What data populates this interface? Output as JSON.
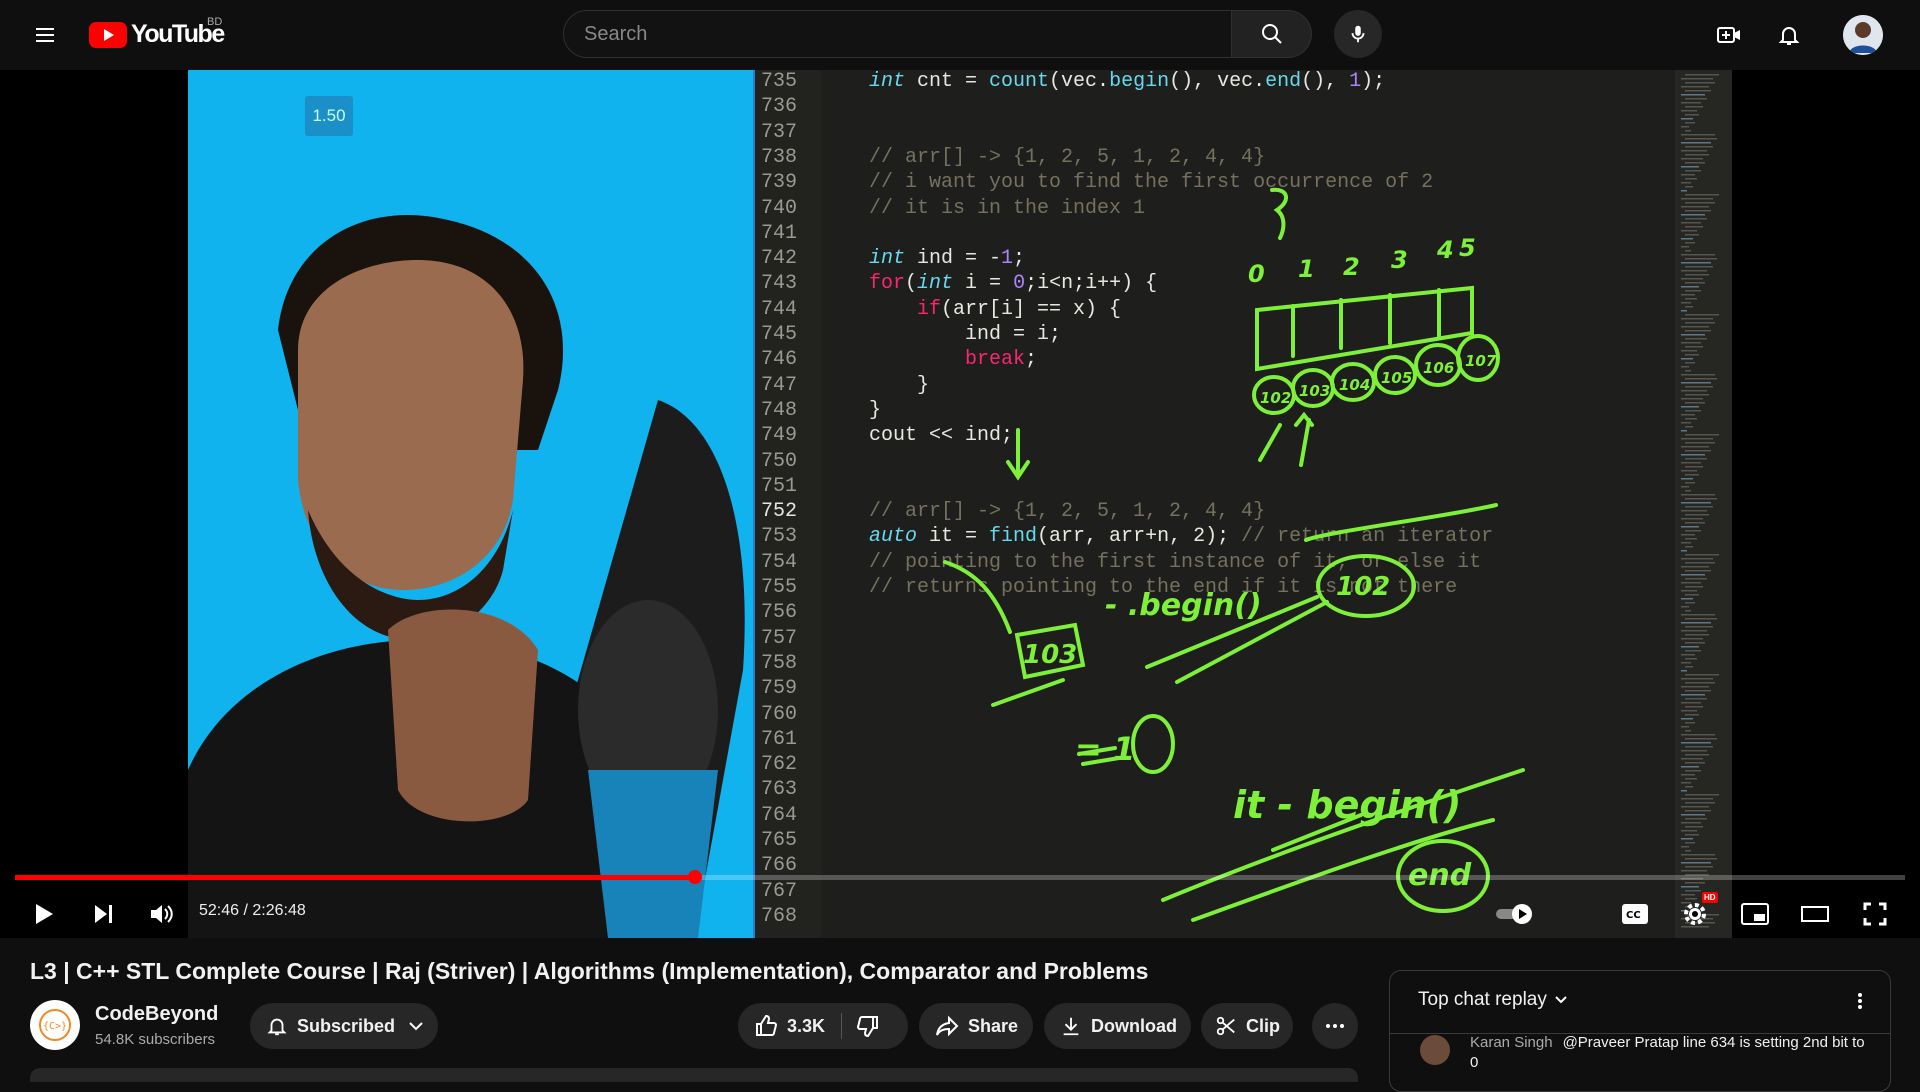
{
  "masthead": {
    "logo_text": "YouTube",
    "country_code": "BD",
    "search_placeholder": "Search"
  },
  "player": {
    "speed_overlay": "1.50",
    "current_time": "52:46",
    "duration": "2:26:48",
    "time_display": "52:46 / 2:26:48",
    "progress_fraction": 0.36,
    "hd_badge": "HD",
    "editor": {
      "line_numbers": [
        "735",
        "736",
        "737",
        "738",
        "739",
        "740",
        "741",
        "742",
        "743",
        "744",
        "745",
        "746",
        "747",
        "748",
        "749",
        "750",
        "751",
        "752",
        "753",
        "754",
        "755",
        "756",
        "757",
        "758",
        "759",
        "760",
        "761",
        "762",
        "763",
        "764",
        "765",
        "766",
        "767",
        "768"
      ],
      "current_line": "752",
      "code": [
        [
          "int",
          " cnt = ",
          "count",
          "(vec.",
          "begin",
          "(), vec.",
          "end",
          "(), ",
          "1",
          ");"
        ],
        [],
        [],
        [
          "// arr[] -> {1, 2, 5, 1, 2, 4, 4}"
        ],
        [
          "// i want you to find the first occurrence of 2"
        ],
        [
          "// it is in the index 1"
        ],
        [],
        [
          "int",
          " ind = -",
          "1",
          ";"
        ],
        [
          "for",
          "(",
          "int",
          " i = ",
          "0",
          ";i<n;i++) {"
        ],
        [
          "    ",
          "if",
          "(arr[i] == x) {"
        ],
        [
          "        ind = i;"
        ],
        [
          "        ",
          "break",
          ";"
        ],
        [
          "    }"
        ],
        [
          "}"
        ],
        [
          "cout << ind;"
        ],
        [],
        [],
        [
          "// arr[] -> {1, 2, 5, 1, 2, 4, 4}"
        ],
        [
          "auto",
          " it = ",
          "find",
          "(arr, arr+n, 2); ",
          "// return an iterator"
        ],
        [
          "// pointing to the first instance of it, or else it"
        ],
        [
          "// returns pointing to the end if it is not there"
        ]
      ],
      "handwriting": [
        "0",
        "1",
        "2",
        "3",
        "4",
        "5",
        "102",
        "103",
        "104",
        "105",
        "106",
        "107",
        "103",
        "- .begin()",
        "102",
        "= 1",
        "it - begin()",
        "end"
      ]
    }
  },
  "video": {
    "title": "L3 | C++ STL Complete Course | Raj (Striver) | Algorithms (Implementation), Comparator and Problems"
  },
  "channel": {
    "name": "CodeBeyond",
    "subscribers": "54.8K subscribers",
    "subscribe_label": "Subscribed",
    "avatar_text": "{C>}"
  },
  "actions": {
    "likes": "3.3K",
    "share": "Share",
    "download": "Download",
    "clip": "Clip"
  },
  "chat": {
    "header": "Top chat replay",
    "messages": [
      {
        "author": "Karan Singh",
        "text": "@Praveer Pratap line 634 is setting 2nd bit to 0"
      }
    ]
  }
}
